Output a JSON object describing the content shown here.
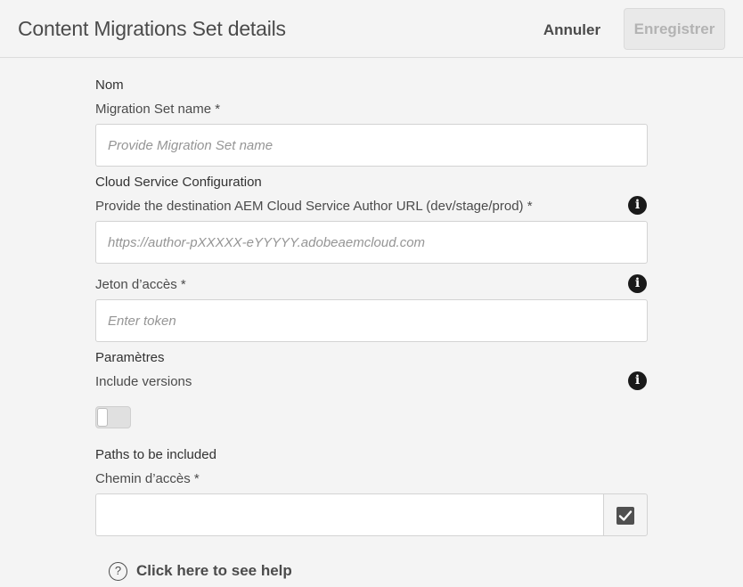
{
  "header": {
    "title": "Content Migrations Set details",
    "cancel_label": "Annuler",
    "save_label": "Enregistrer"
  },
  "sections": {
    "name": {
      "heading": "Nom",
      "field_label": "Migration Set name *",
      "placeholder": "Provide Migration Set name",
      "value": ""
    },
    "cloud": {
      "heading": "Cloud Service Configuration",
      "url_label": "Provide the destination AEM Cloud Service Author URL (dev/stage/prod) *",
      "url_placeholder": "https://author-pXXXXX-eYYYYY.adobeaemcloud.com",
      "token_label": "Jeton d’accès *",
      "token_placeholder": "Enter token"
    },
    "params": {
      "heading": "Paramètres",
      "versions_label": "Include versions",
      "versions_enabled": false
    },
    "paths": {
      "heading": "Paths to be included",
      "path_label": "Chemin d’accès *",
      "value": ""
    }
  },
  "help": {
    "icon_glyph": "?",
    "text": "Click here to see help"
  },
  "icons": {
    "info": "i",
    "check": "✓"
  }
}
